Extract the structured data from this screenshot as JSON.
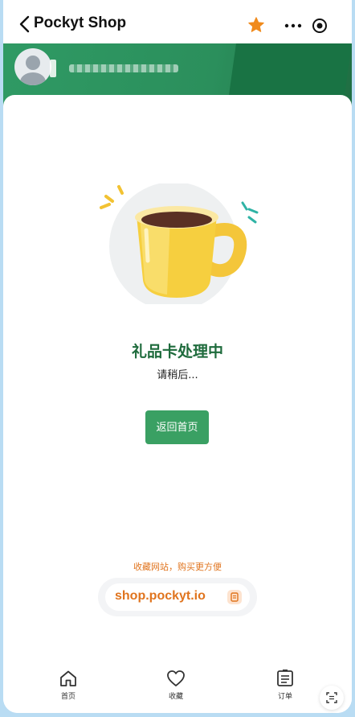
{
  "titlebar": {
    "title": "Pockyt Shop",
    "back_icon": "chevron-left-icon",
    "favorite_icon": "star-icon",
    "more_icon": "more-icon",
    "close_icon": "target-icon",
    "favorite_color": "#f08a1c"
  },
  "header": {
    "avatar_icon": "user-avatar-icon",
    "accent": "#2b8f5c"
  },
  "status": {
    "title": "礼品卡处理中",
    "subtitle": "请稍后...",
    "illustration": "coffee-cup-illustration"
  },
  "actions": {
    "home_button_label": "返回首页",
    "button_color": "#3aa063"
  },
  "bookmark": {
    "tip": "收藏网站，购买更方便",
    "url": "shop.pockyt.io",
    "copy_icon": "copy-icon"
  },
  "tabbar": {
    "items": [
      {
        "label": "首页",
        "icon": "home-icon"
      },
      {
        "label": "收藏",
        "icon": "heart-icon"
      },
      {
        "label": "订单",
        "icon": "order-list-icon"
      }
    ],
    "scan_icon": "scan-icon"
  }
}
